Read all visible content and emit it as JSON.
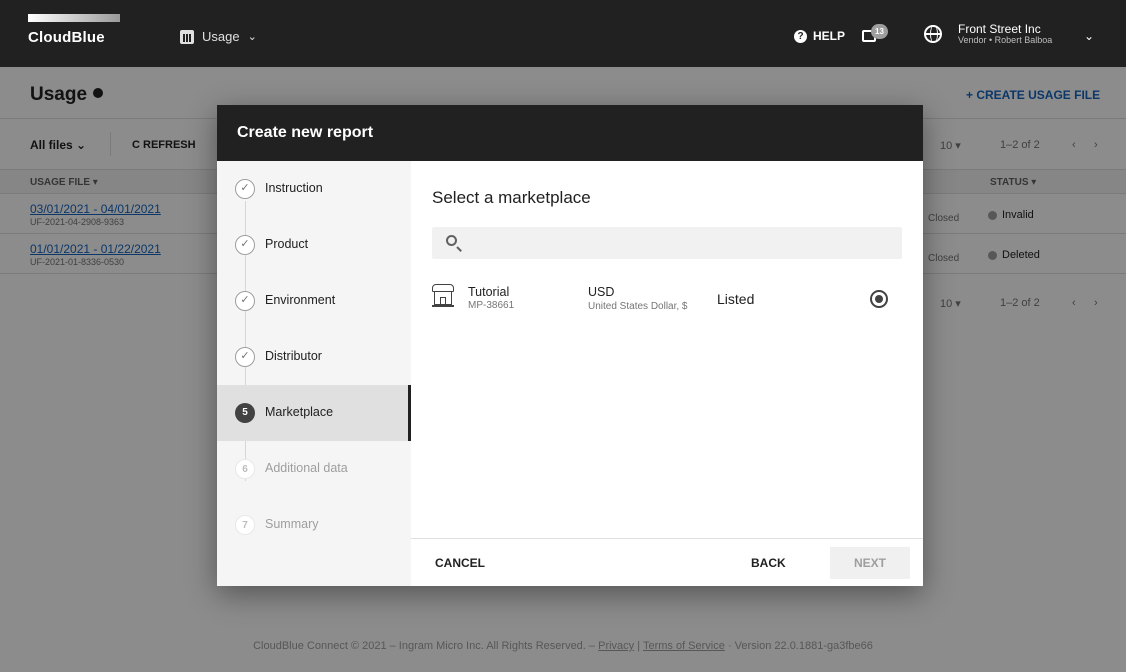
{
  "topbar": {
    "logo_text": "CloudBlue",
    "module": "Usage",
    "help": "HELP",
    "notifications_count": "13",
    "account_name": "Front Street Inc",
    "account_sub": "Vendor • Robert Balboa"
  },
  "page": {
    "title": "Usage",
    "create_button": "+ CREATE USAGE FILE",
    "filter": "All files ⌄",
    "refresh": "C REFRESH",
    "per_page": "10 ▾",
    "range": "1–2 of 2",
    "prev": "‹",
    "next": "›",
    "columns": {
      "usage_file": "USAGE FILE ▾",
      "status": "STATUS ▾"
    },
    "rows": [
      {
        "title": "03/01/2021 - 04/01/2021",
        "id": "UF-2021-04-2908-9363",
        "state": "Closed",
        "status": "Invalid"
      },
      {
        "title": "01/01/2021 - 01/22/2021",
        "id": "UF-2021-01-8336-0530",
        "state": "Closed",
        "status": "Deleted"
      }
    ],
    "footer_text": "CloudBlue Connect © 2021 – Ingram Micro Inc. All Rights Reserved. –",
    "footer_privacy": "Privacy",
    "footer_sep": "|",
    "footer_terms": "Terms of Service",
    "footer_version": "· Version 22.0.1881-ga3fbe66"
  },
  "dialog": {
    "title": "Create new report",
    "steps": [
      {
        "num": "1",
        "label": "Instruction",
        "state": "done"
      },
      {
        "num": "2",
        "label": "Product",
        "state": "done"
      },
      {
        "num": "3",
        "label": "Environment",
        "state": "done"
      },
      {
        "num": "4",
        "label": "Distributor",
        "state": "done"
      },
      {
        "num": "5",
        "label": "Marketplace",
        "state": "current"
      },
      {
        "num": "6",
        "label": "Additional data",
        "state": "todo"
      },
      {
        "num": "7",
        "label": "Summary",
        "state": "todo"
      }
    ],
    "content_title": "Select a marketplace",
    "search_value": "",
    "marketplace": {
      "name": "Tutorial",
      "id": "MP-38661",
      "currency": "USD",
      "currency_full": "United States Dollar, $",
      "status": "Listed"
    },
    "cancel": "CANCEL",
    "back": "BACK",
    "next": "NEXT"
  }
}
